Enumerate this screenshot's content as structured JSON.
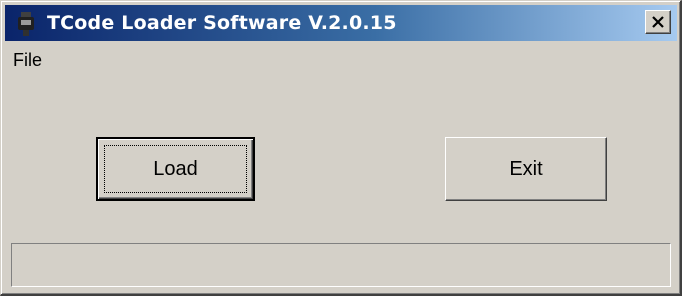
{
  "window": {
    "title": "TCode Loader Software V.2.0.15",
    "icon": "tcode-app-icon",
    "close_icon": "close-x-icon"
  },
  "menu": {
    "items": [
      {
        "label": "File"
      }
    ]
  },
  "buttons": {
    "load_label": "Load",
    "exit_label": "Exit"
  },
  "statusbar": {
    "text": ""
  },
  "colors": {
    "title_gradient_start": "#0a246a",
    "title_gradient_end": "#a6caf0",
    "window_face": "#d4d0c8",
    "title_text": "#ffffff"
  }
}
